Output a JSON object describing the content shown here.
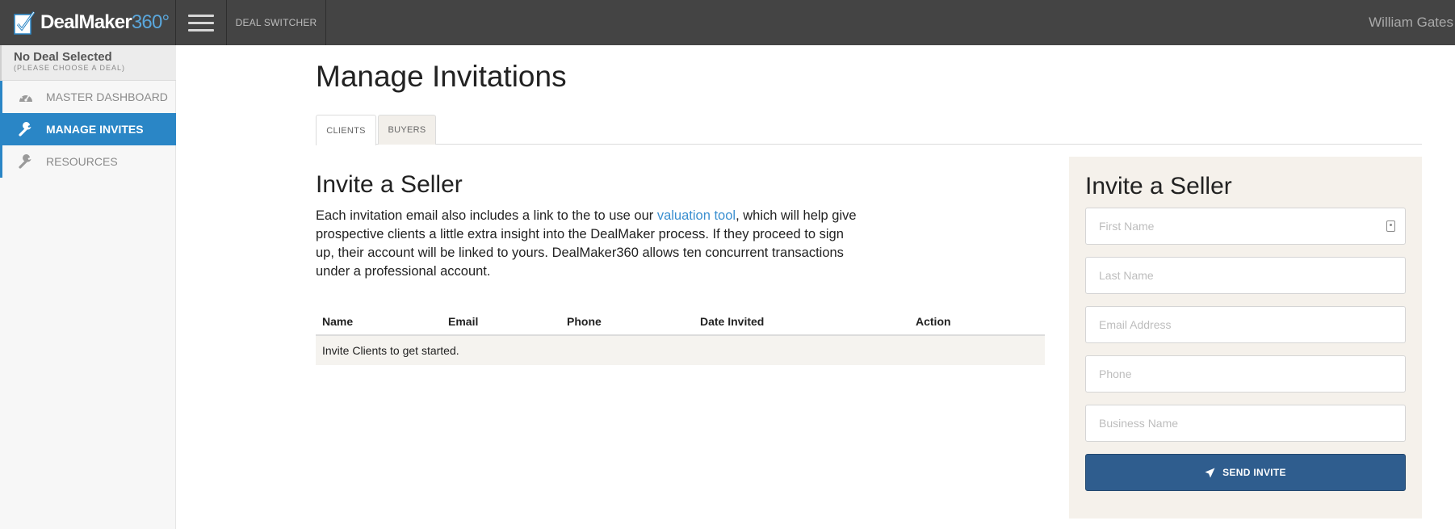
{
  "header": {
    "logo_text": "DealMaker",
    "logo_num": "360°",
    "deal_switcher_label": "DEAL SWITCHER",
    "user_name": "William Gates"
  },
  "sidebar": {
    "deal_title": "No Deal Selected",
    "deal_subtitle": "(PLEASE CHOOSE A DEAL)",
    "items": [
      {
        "label": "MASTER DASHBOARD",
        "icon": "dashboard-icon",
        "active": false
      },
      {
        "label": "MANAGE INVITES",
        "icon": "wrench-icon",
        "active": true
      },
      {
        "label": "RESOURCES",
        "icon": "wrench-icon",
        "active": false
      }
    ]
  },
  "main": {
    "title": "Manage Invitations",
    "tabs": [
      {
        "label": "CLIENTS",
        "active": true
      },
      {
        "label": "BUYERS",
        "active": false
      }
    ],
    "section_title": "Invite a Seller",
    "description_before_link": "Each invitation email also includes a link to the to use our ",
    "description_link": "valuation tool",
    "description_after_link": ", which will help give prospective clients a little extra insight into the DealMaker process. If they proceed to sign up, their account will be linked to yours. DealMaker360 allows ten concurrent transactions under a professional account.",
    "table": {
      "columns": [
        "Name",
        "Email",
        "Phone",
        "Date Invited",
        "Action"
      ],
      "empty_message": "Invite Clients to get started."
    }
  },
  "invite_panel": {
    "title": "Invite a Seller",
    "fields": [
      {
        "placeholder": "First Name"
      },
      {
        "placeholder": "Last Name"
      },
      {
        "placeholder": "Email Address"
      },
      {
        "placeholder": "Phone"
      },
      {
        "placeholder": "Business Name"
      }
    ],
    "send_label": "SEND INVITE"
  },
  "colors": {
    "topbar": "#444444",
    "accent": "#2a86c6",
    "button": "#2f5d8e",
    "link": "#3a8fd0",
    "panel_bg": "#f5f1eb"
  }
}
